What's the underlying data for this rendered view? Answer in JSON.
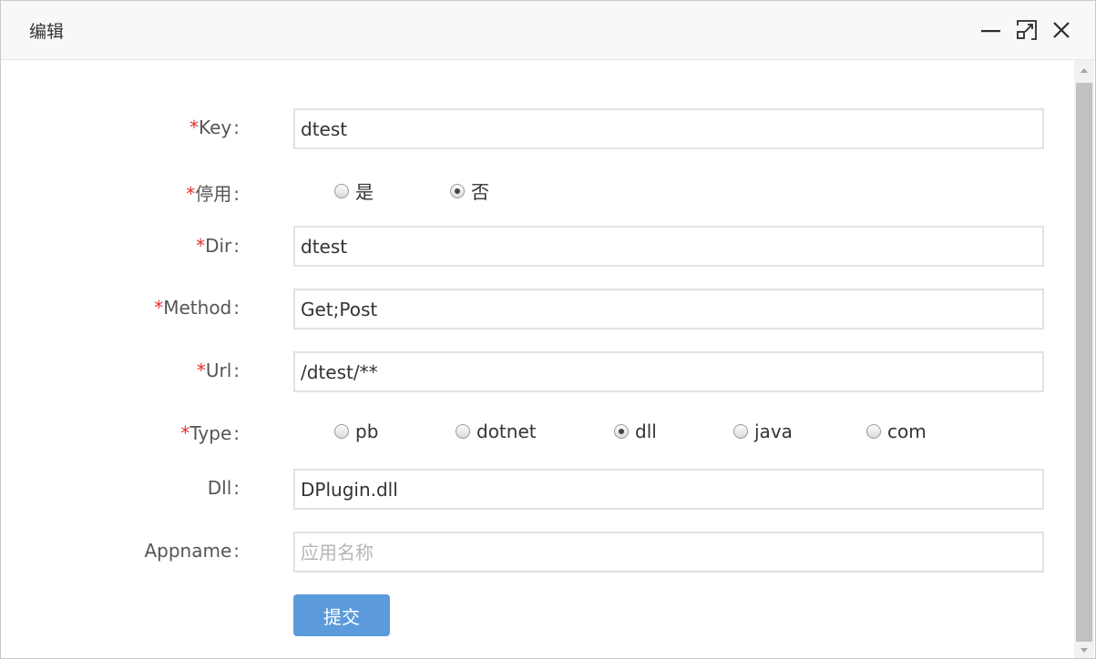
{
  "dialog": {
    "title": "编辑",
    "controls": {
      "minimize": "minimize-icon",
      "maximize": "maximize-icon",
      "close": "close-icon"
    }
  },
  "form": {
    "key": {
      "label": "Key",
      "colon": ":",
      "required": "*",
      "value": "dtest"
    },
    "disabled": {
      "label": "停用",
      "colon": ":",
      "required": "*",
      "options": [
        "是",
        "否"
      ],
      "selected": "否"
    },
    "dir": {
      "label": "Dir",
      "colon": ":",
      "required": "*",
      "value": "dtest"
    },
    "method": {
      "label": "Method",
      "colon": ":",
      "required": "*",
      "value": "Get;Post"
    },
    "url": {
      "label": "Url",
      "colon": ":",
      "required": "*",
      "value": "/dtest/**"
    },
    "type": {
      "label": "Type",
      "colon": ":",
      "required": "*",
      "options": [
        "pb",
        "dotnet",
        "dll",
        "java",
        "com"
      ],
      "selected": "dll"
    },
    "dll": {
      "label": "Dll",
      "colon": ":",
      "value": "DPlugin.dll"
    },
    "appname": {
      "label": "Appname",
      "colon": ":",
      "value": "",
      "placeholder": "应用名称"
    },
    "submit_label": "提交"
  },
  "colors": {
    "required": "#e0322f",
    "submit_bg": "#5b9bdc",
    "titlebar_bg": "#f8f8f8"
  }
}
